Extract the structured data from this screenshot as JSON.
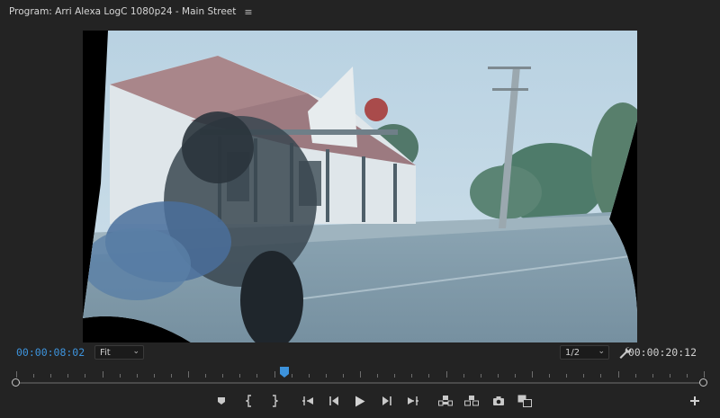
{
  "panel": {
    "title": "Program: Arri Alexa LogC 1080p24 - Main Street",
    "menu_icon": "hamburger-menu-icon"
  },
  "viewer": {
    "image": "Motorcycle rider passing a country pub on a rural street, Log C footage with warp-stabilizer edges"
  },
  "timecode": {
    "current": "00:00:08:02",
    "duration": "00:00:20:12",
    "current_color": "#3d93dc"
  },
  "zoom": {
    "selected": "Fit"
  },
  "resolution": {
    "selected": "1/2"
  },
  "playhead": {
    "color": "#3d93dc"
  },
  "controls": [
    {
      "name": "add-marker-button",
      "icon": "marker-icon"
    },
    {
      "name": "mark-in-button",
      "icon": "mark-in-icon"
    },
    {
      "name": "mark-out-button",
      "icon": "mark-out-icon"
    },
    {
      "name": "go-to-in-button",
      "icon": "go-to-in-icon"
    },
    {
      "name": "step-back-button",
      "icon": "step-back-icon"
    },
    {
      "name": "play-button",
      "icon": "play-icon"
    },
    {
      "name": "step-forward-button",
      "icon": "step-forward-icon"
    },
    {
      "name": "go-to-out-button",
      "icon": "go-to-out-icon"
    },
    {
      "name": "lift-button",
      "icon": "lift-icon"
    },
    {
      "name": "extract-button",
      "icon": "extract-icon"
    },
    {
      "name": "export-frame-button",
      "icon": "camera-icon"
    },
    {
      "name": "comparison-view-button",
      "icon": "comparison-view-icon"
    },
    {
      "name": "button-editor-button",
      "icon": "plus-icon"
    }
  ]
}
